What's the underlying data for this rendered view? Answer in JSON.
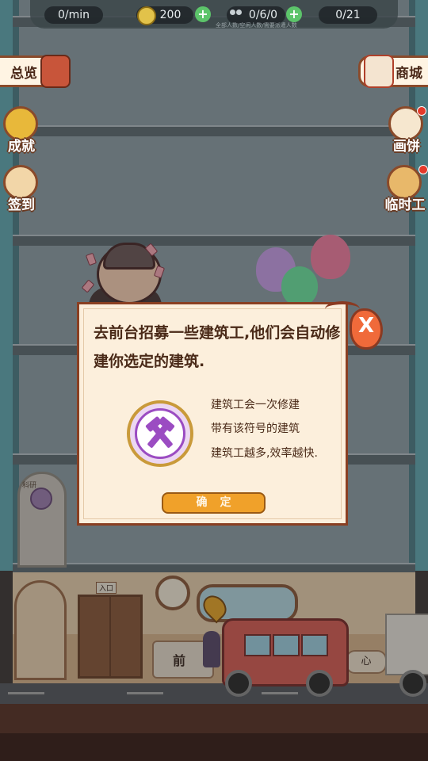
{
  "hud": {
    "income": "0/min",
    "coins": "200",
    "workers": "0/6/0",
    "workers_sub": "全部人数/空闲人数/需要派遣人数",
    "capacity": "0/21",
    "plus_label": "+"
  },
  "left_menu": {
    "overview": "总览",
    "achievements": "成就",
    "checkin": "签到"
  },
  "right_menu": {
    "shop": "商城",
    "draw": "画饼",
    "temp_worker": "临时工"
  },
  "dialog": {
    "message": "去前台招募一些建筑工,他们会自动修建你选定的建筑.",
    "hint_line1": "建筑工会一次修建",
    "hint_line2": "带有该符号的建筑",
    "hint_line3": "建筑工越多,效率越快.",
    "confirm": "确定",
    "close": "X"
  },
  "scene": {
    "front_desk_sign": "前",
    "arch_sign": "科研",
    "door_sign": "入口",
    "side_sign": "心"
  },
  "colors": {
    "modal_bg": "#fcefdc",
    "modal_border": "#8a3f22",
    "confirm_button": "#f0a12a",
    "badge_purple": "#9b4cc2",
    "coin_gold": "#e2c24a",
    "plus_green": "#5cc46a"
  },
  "icons": {
    "builder_badge": "crossed-hammers-icon",
    "close": "close-icon",
    "coin": "coin-icon",
    "workers": "people-icon"
  }
}
